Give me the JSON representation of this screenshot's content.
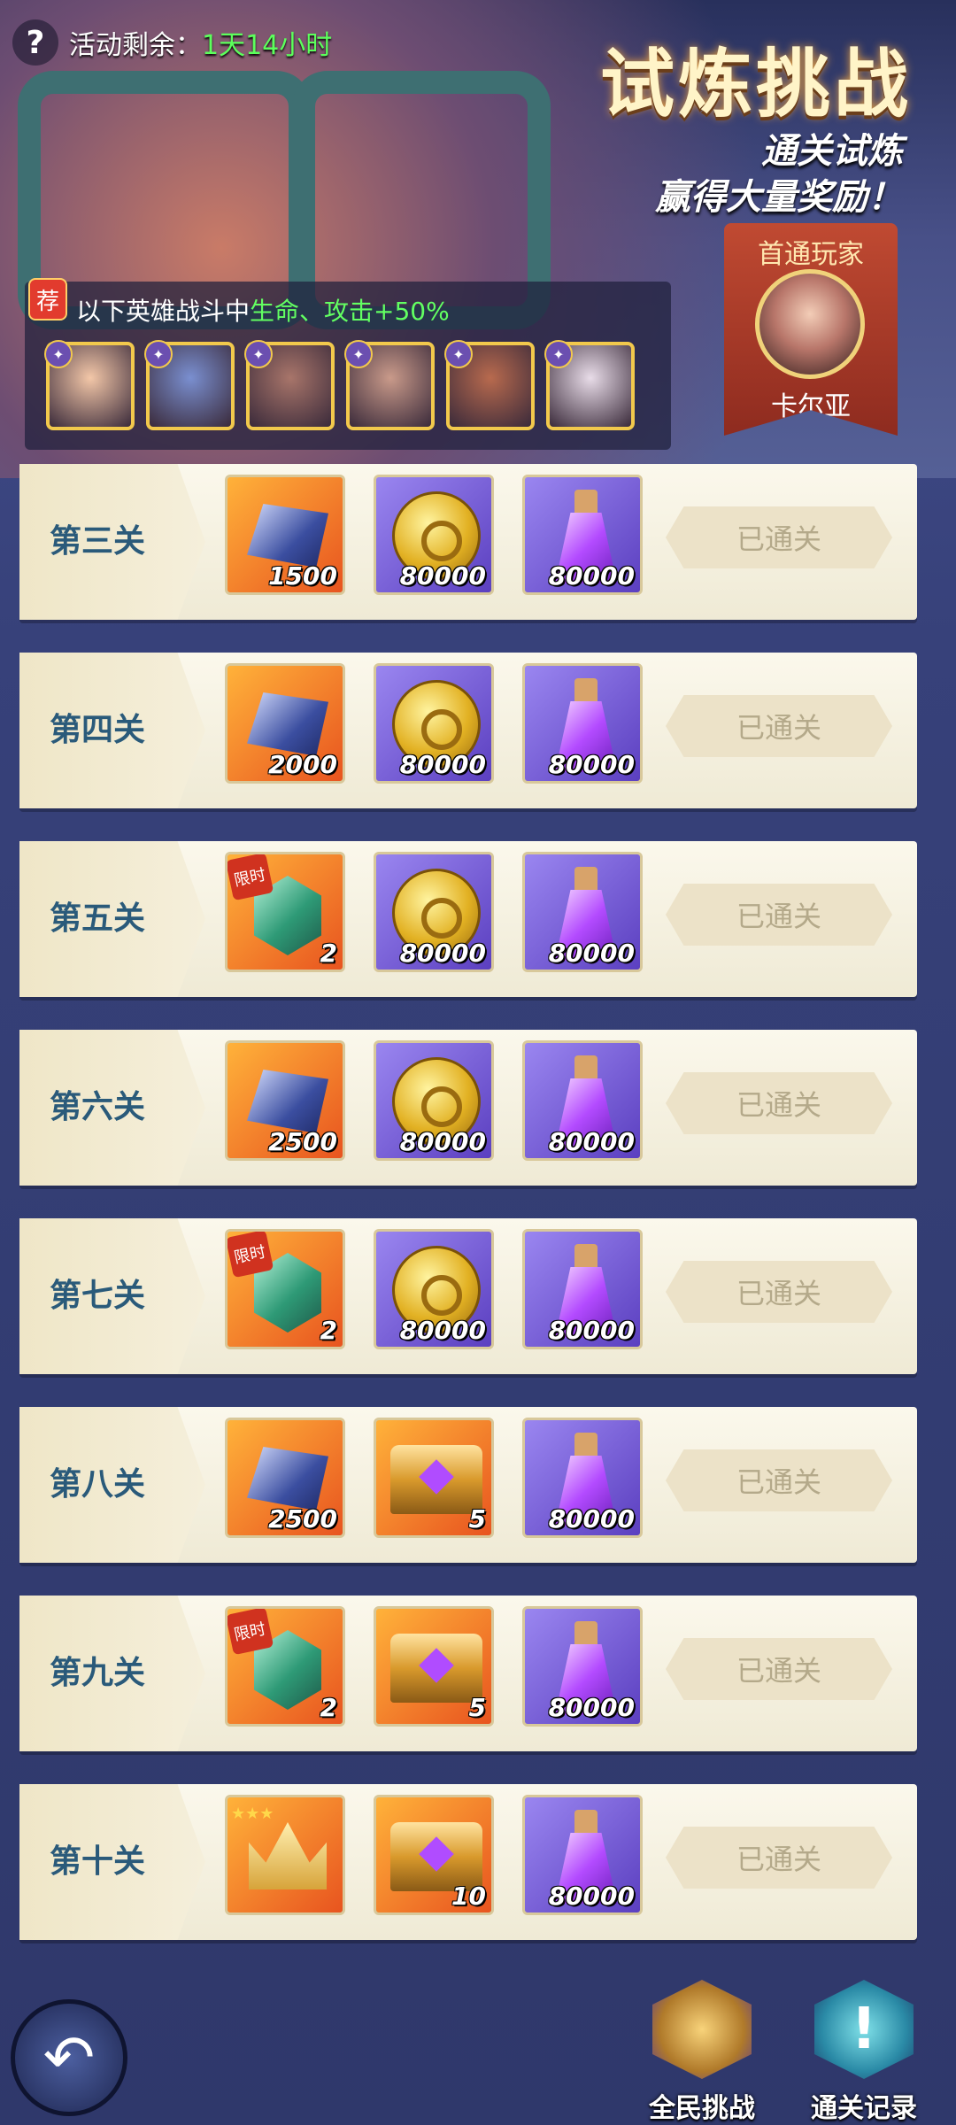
{
  "header": {
    "help_icon": "question-mark-icon",
    "timer_label": "活动剩余：",
    "timer_value": "1天14小时",
    "title": "试炼挑战",
    "subtitle_line1": "通关试炼",
    "subtitle_line2": "赢得大量奖励！"
  },
  "first_clear": {
    "title": "首通玩家",
    "player_name": "卡尔亚"
  },
  "buff": {
    "badge": "荐",
    "text_prefix": "以下英雄战斗中",
    "text_highlight": "生命、攻击+50%",
    "heroes": [
      {
        "name": "hero-1",
        "color": "#f3c7a8"
      },
      {
        "name": "hero-2",
        "color": "#7a8fd0"
      },
      {
        "name": "hero-3",
        "color": "#a8756a"
      },
      {
        "name": "hero-4",
        "color": "#c99a8a"
      },
      {
        "name": "hero-5",
        "color": "#b86a4e"
      },
      {
        "name": "hero-6",
        "color": "#e8dce8"
      }
    ]
  },
  "stages": [
    {
      "label": "第三关",
      "status": "已通关",
      "rewards": [
        {
          "type": "gem",
          "qty": "1500"
        },
        {
          "type": "coin",
          "qty": "80000"
        },
        {
          "type": "potion",
          "qty": "80000"
        }
      ]
    },
    {
      "label": "第四关",
      "status": "已通关",
      "rewards": [
        {
          "type": "gem",
          "qty": "2000"
        },
        {
          "type": "coin",
          "qty": "80000"
        },
        {
          "type": "potion",
          "qty": "80000"
        }
      ]
    },
    {
      "label": "第五关",
      "status": "已通关",
      "rewards": [
        {
          "type": "token",
          "qty": "2",
          "tag": "限时"
        },
        {
          "type": "coin",
          "qty": "80000"
        },
        {
          "type": "potion",
          "qty": "80000"
        }
      ]
    },
    {
      "label": "第六关",
      "status": "已通关",
      "rewards": [
        {
          "type": "gem",
          "qty": "2500"
        },
        {
          "type": "coin",
          "qty": "80000"
        },
        {
          "type": "potion",
          "qty": "80000"
        }
      ]
    },
    {
      "label": "第七关",
      "status": "已通关",
      "rewards": [
        {
          "type": "token",
          "qty": "2",
          "tag": "限时"
        },
        {
          "type": "coin",
          "qty": "80000"
        },
        {
          "type": "potion",
          "qty": "80000"
        }
      ]
    },
    {
      "label": "第八关",
      "status": "已通关",
      "rewards": [
        {
          "type": "gem",
          "qty": "2500"
        },
        {
          "type": "chest",
          "qty": "5"
        },
        {
          "type": "potion",
          "qty": "80000"
        }
      ]
    },
    {
      "label": "第九关",
      "status": "已通关",
      "rewards": [
        {
          "type": "token",
          "qty": "2",
          "tag": "限时"
        },
        {
          "type": "chest",
          "qty": "5"
        },
        {
          "type": "potion",
          "qty": "80000"
        }
      ]
    },
    {
      "label": "第十关",
      "status": "已通关",
      "rewards": [
        {
          "type": "crown",
          "qty": ""
        },
        {
          "type": "chest",
          "qty": "10"
        },
        {
          "type": "potion",
          "qty": "80000"
        }
      ]
    }
  ],
  "footer": {
    "back_icon": "back-arrow-icon",
    "all_challenge_label": "全民挑战",
    "records_label": "通关记录"
  }
}
